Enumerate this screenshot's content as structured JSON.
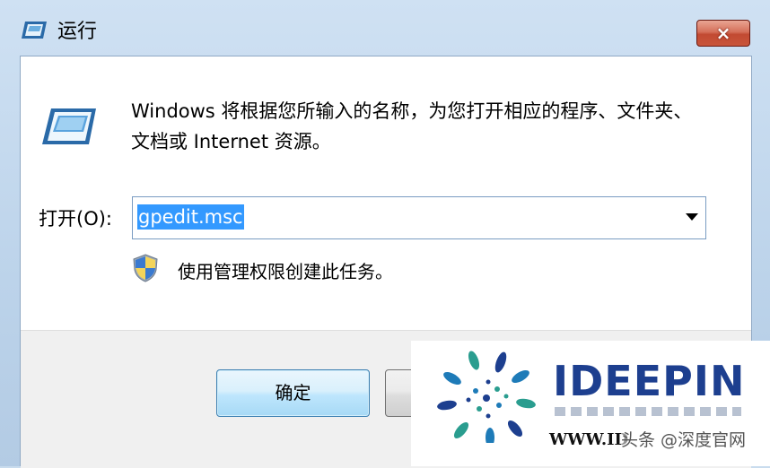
{
  "window": {
    "title": "运行",
    "close_icon": "×",
    "close_icon_name": "close-icon",
    "colors": {
      "titlebar": "#c9dcee",
      "close_button": "#c8553b",
      "selection": "#3399ff",
      "brand": "#1d3f8f"
    }
  },
  "content": {
    "icon": "run-icon",
    "description": "Windows 将根据您所输入的名称，为您打开相应的程序、文件夹、文档或 Internet 资源。",
    "open_label": "打开(O):",
    "input_value": "gpedit.msc",
    "shield_icon": "uac-shield-icon",
    "admin_note": "使用管理权限创建此任务。"
  },
  "buttons": {
    "ok_label": "确定",
    "cancel_label": ""
  },
  "watermark": {
    "brand": "IDEEPIN",
    "url": "WWW.ID",
    "credit": "头条 @深度官网"
  }
}
